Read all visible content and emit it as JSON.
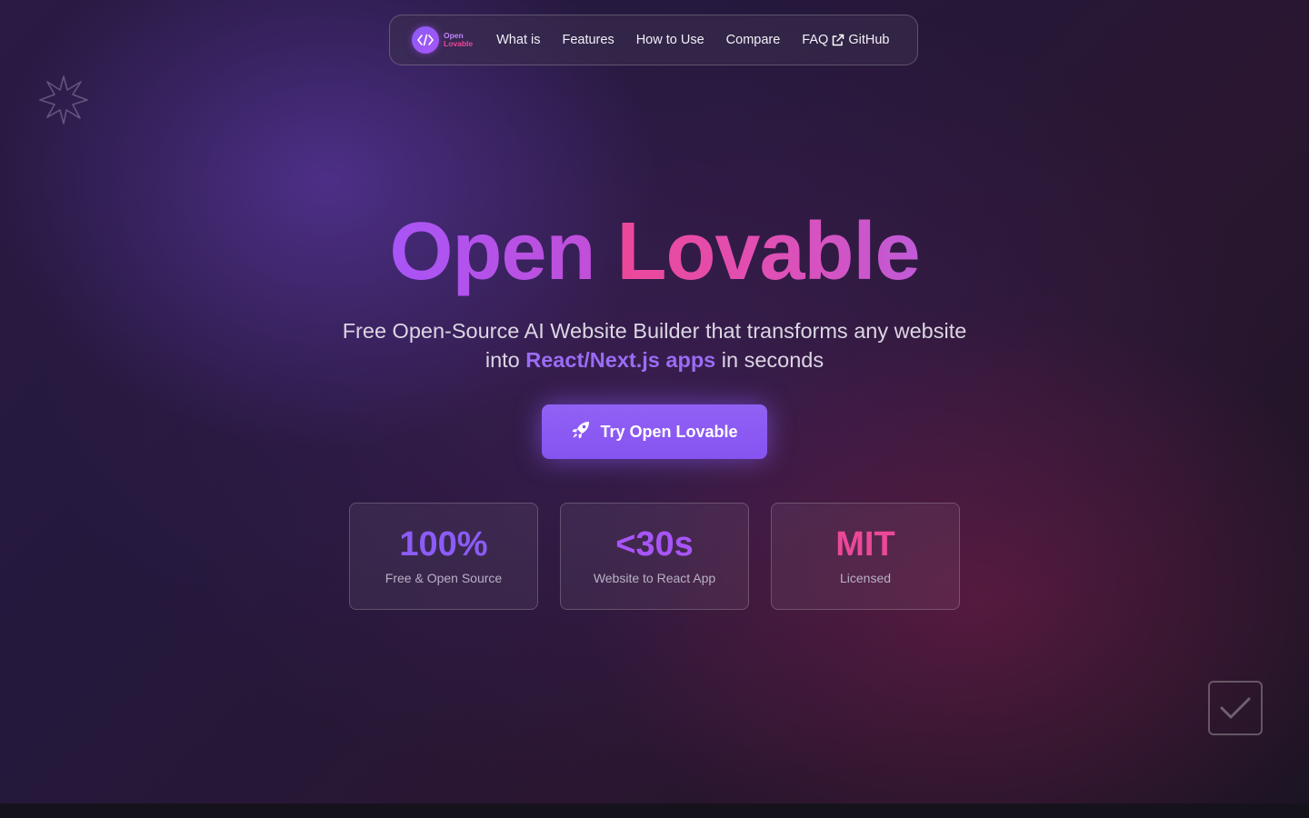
{
  "nav": {
    "brand_line1": "Open",
    "brand_line2": "Lovable",
    "links": [
      "What is",
      "Features",
      "How to Use",
      "Compare",
      "FAQ"
    ],
    "github_label": "GitHub"
  },
  "hero": {
    "title_part1": "Open",
    "title_part2": "Lovable",
    "subtitle_line1": "Free Open-Source AI Website Builder that transforms any website",
    "subtitle_pre": "into",
    "subtitle_highlight": "React/Next.js apps",
    "subtitle_post": "in seconds",
    "cta_label": "Try Open Lovable"
  },
  "stats": [
    {
      "value": "100%",
      "label": "Free & Open Source",
      "color": "#8b5cf6"
    },
    {
      "value": "<30s",
      "label": "Website to React App",
      "color": "#a855f7"
    },
    {
      "value": "MIT",
      "label": "Licensed",
      "color": "#ec4899"
    }
  ],
  "colors": {
    "accent": "#8b5cf6",
    "pink": "#ec4899"
  }
}
